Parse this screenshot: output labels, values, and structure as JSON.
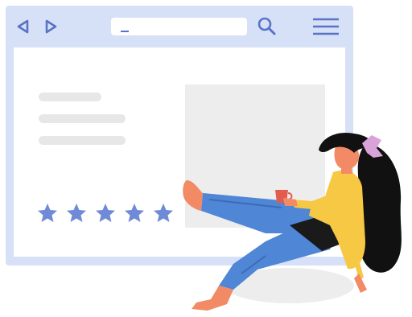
{
  "browser": {
    "address_bar": {
      "value": "",
      "caret": "_"
    },
    "icons": {
      "back": "triangle-left-icon",
      "forward": "triangle-right-icon",
      "search": "search-icon",
      "menu": "hamburger-menu-icon"
    }
  },
  "product": {
    "rating": {
      "value": 5,
      "max": 5
    }
  },
  "colors": {
    "frame": "#d6e0f7",
    "accent": "#5a73c7",
    "star": "#6f8bd8",
    "placeholder": "#ededed",
    "text_line": "#e7e7e7",
    "shirt": "#f7c843",
    "jeans": "#4f86d6",
    "hair": "#111111",
    "skin": "#f28b65",
    "bow": "#d9a2d9"
  }
}
